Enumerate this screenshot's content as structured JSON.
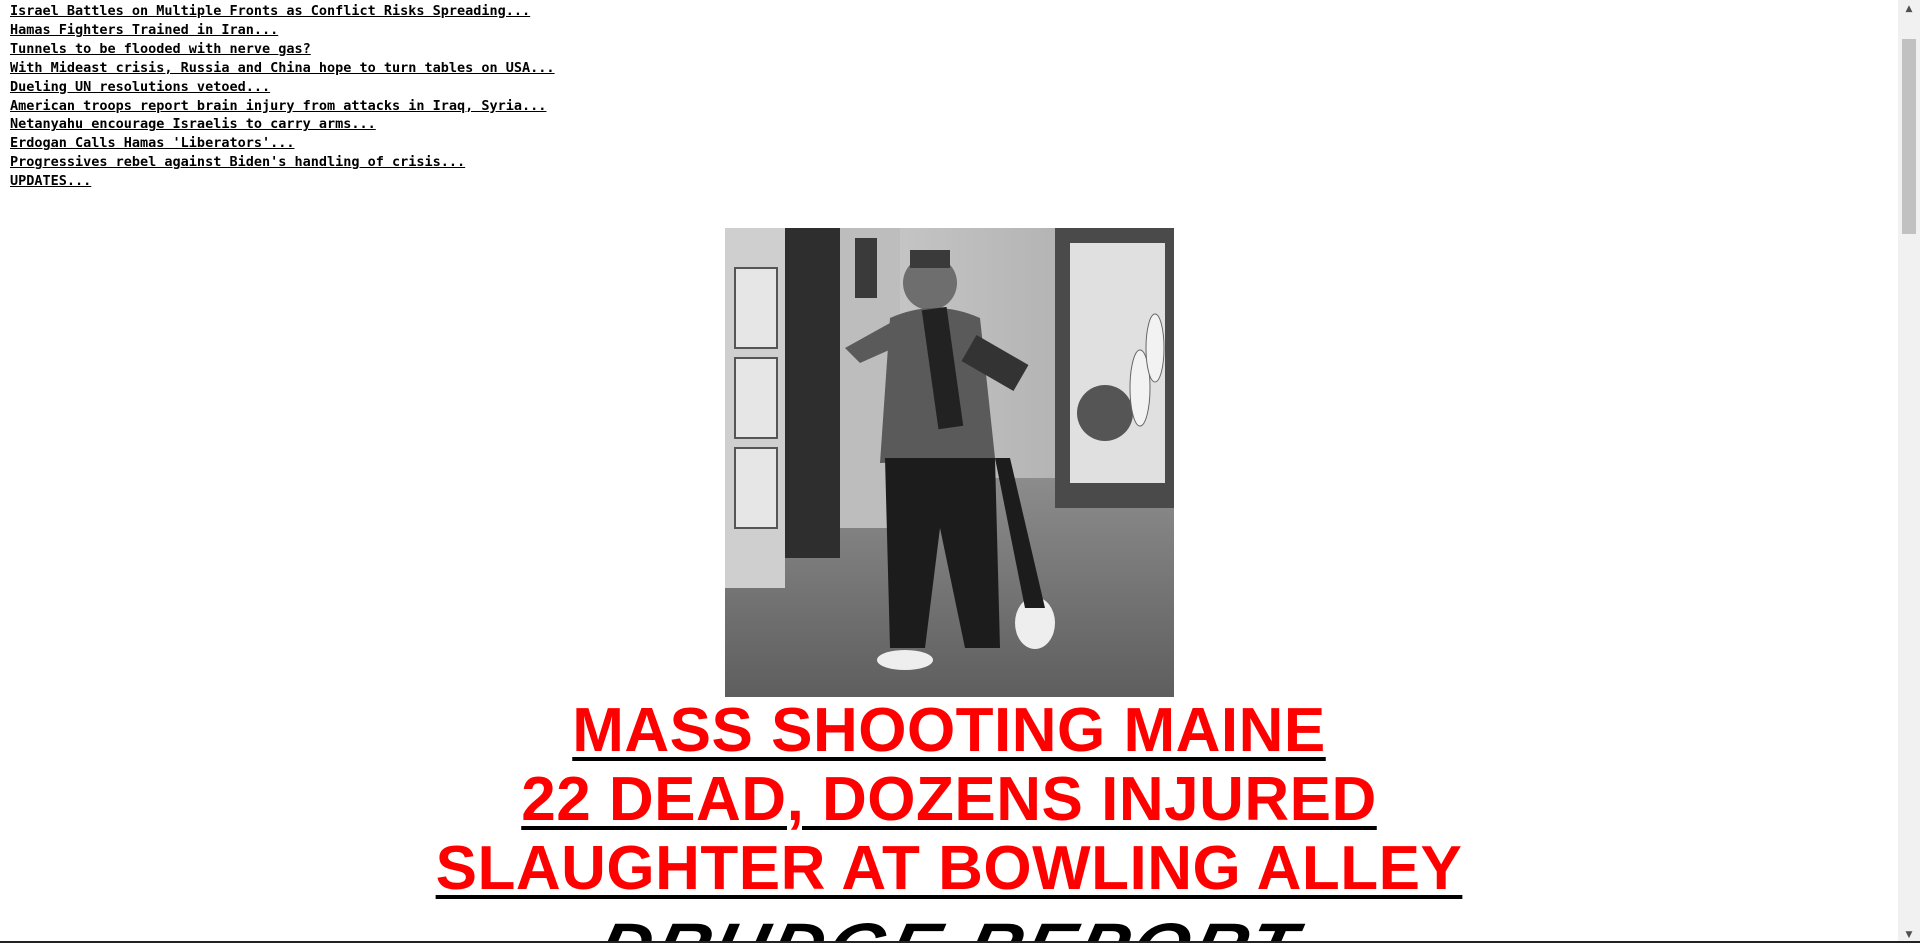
{
  "links": [
    "Israel Battles on Multiple Fronts as Conflict Risks Spreading...",
    "Hamas Fighters Trained in Iran...",
    "Tunnels to be flooded with nerve gas?",
    "With Mideast crisis, Russia and China hope to turn tables on USA...",
    "Dueling UN resolutions vetoed...",
    "American troops report brain injury from attacks in Iraq, Syria...",
    "Netanyahu encourage Israelis to carry arms...",
    "Erdogan Calls Hamas 'Liberators'...",
    "Progressives rebel against Biden's handling of crisis...",
    "UPDATES..."
  ],
  "headline": {
    "line1": "MASS SHOOTING MAINE",
    "line2": "22 DEAD, DOZENS INJURED",
    "line3": "SLAUGHTER AT BOWLING ALLEY",
    "color": "#ff0000"
  },
  "logo": {
    "text": "DRUDGE REPORT"
  },
  "photo": {
    "icon": "surveillance-photo-gunman"
  }
}
